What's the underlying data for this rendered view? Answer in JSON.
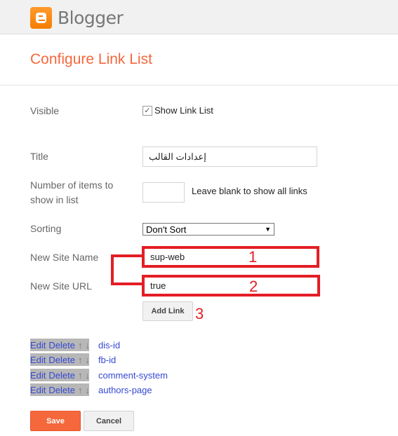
{
  "header": {
    "brand": "Blogger"
  },
  "page": {
    "title": "Configure Link List"
  },
  "form": {
    "visible_label": "Visible",
    "show_link_list": "Show Link List",
    "show_link_list_checked": true,
    "title_label": "Title",
    "title_value": "إعدادات القالب",
    "items_label_1": "Number of items to",
    "items_label_2": "show in list",
    "items_value": "",
    "items_hint": "Leave blank to show all links",
    "sorting_label": "Sorting",
    "sorting_value": "Don't Sort",
    "site_name_label": "New Site Name",
    "site_name_value": "sup-web",
    "site_url_label": "New Site URL",
    "site_url_value": "true",
    "add_link": "Add Link"
  },
  "annotations": [
    "1",
    "2",
    "3"
  ],
  "links": {
    "edit": "Edit",
    "delete": "Delete",
    "up": "↑",
    "down": "↓",
    "items": [
      {
        "name": "dis-id"
      },
      {
        "name": "fb-id"
      },
      {
        "name": "comment-system"
      },
      {
        "name": "authors-page"
      }
    ]
  },
  "actions": {
    "save": "Save",
    "cancel": "Cancel"
  },
  "colors": {
    "accent": "#f4683c",
    "annotation": "#e41e25",
    "link": "#3548d2"
  }
}
